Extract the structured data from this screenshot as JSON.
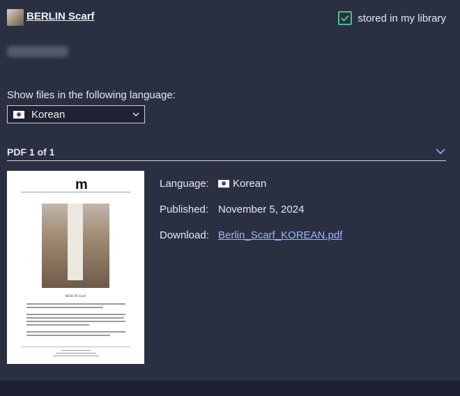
{
  "header": {
    "title": "BERLIN Scarf",
    "stored_label": "stored in my library",
    "stored_checked": true
  },
  "language_select": {
    "label": "Show files in the following language:",
    "value": "Korean",
    "flag_icon": "south-korea-flag-icon"
  },
  "section": {
    "title": "PDF 1 of 1",
    "toggle_icon": "chevron-down-icon"
  },
  "details": {
    "language_label": "Language:",
    "language_value": "Korean",
    "published_label": "Published:",
    "published_value": "November 5, 2024",
    "download_label": "Download:",
    "download_file": "Berlin_Scarf_KOREAN.pdf"
  },
  "colors": {
    "background": "#2b2f42",
    "checkbox": "#49c28a",
    "link": "#9fb4ff"
  }
}
